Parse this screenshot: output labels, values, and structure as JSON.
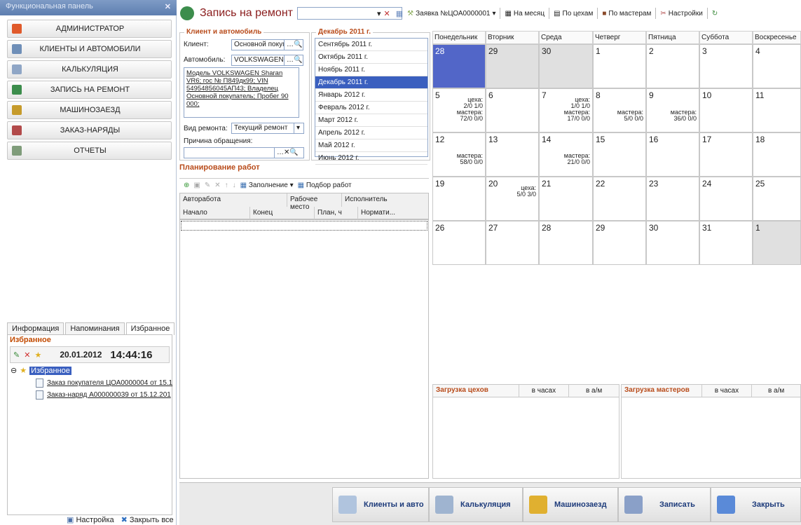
{
  "left_panel": {
    "title": "Функциональная панель",
    "close": "✕",
    "nav": [
      {
        "label": "АДМИНИСТРАТОР",
        "icon": "admin-icon",
        "color": "#e05a2b"
      },
      {
        "label": "КЛИЕНТЫ И АВТОМОБИЛИ",
        "icon": "clients-icon",
        "color": "#6f8fb8"
      },
      {
        "label": "КАЛЬКУЛЯЦИЯ",
        "icon": "calc-icon",
        "color": "#8fa6c6"
      },
      {
        "label": "ЗАПИСЬ НА РЕМОНТ",
        "icon": "record-icon",
        "color": "#3c8d4c"
      },
      {
        "label": "МАШИНОЗАЕЗД",
        "icon": "car-icon",
        "color": "#c69b2b"
      },
      {
        "label": "ЗАКАЗ-НАРЯДЫ",
        "icon": "tools-icon",
        "color": "#b24a4a"
      },
      {
        "label": "ОТЧЕТЫ",
        "icon": "reports-icon",
        "color": "#7f9c7a"
      }
    ],
    "tabs": [
      "Информация",
      "Напоминания",
      "Избранное"
    ],
    "fav_header": "Избранное",
    "date": "20.01.2012",
    "time": "14:44:16",
    "tree_root": "Избранное",
    "items": [
      "Заказ покупателя ЦОА0000004 от 15.1",
      "Заказ-наряд А000000039 от 15.12.201"
    ],
    "footer": [
      "Настройка",
      "Закрыть все"
    ]
  },
  "main": {
    "title": "Запись на ремонт",
    "toolbar": [
      "Заявка №ЦОА0000001",
      "На месяц",
      "По цехам",
      "По мастерам",
      "Настройки"
    ],
    "client_group": "Клиент и автомобиль",
    "client_label": "Клиент:",
    "client_value": "Основной покуг",
    "car_label": "Автомобиль:",
    "car_value": "VOLKSWAGEN !",
    "info": "Модель VOLKSWAGEN Sharan VR6; гос № П849дк99; VIN 54954856045АП43; Владелец Основной покупатель; Пробег 90 000;",
    "repair_label": "Вид ремонта:",
    "repair_value": "Текущий ремонт",
    "reason_label": "Причина обращения:",
    "month_group": "Декабрь 2011 г.",
    "months": [
      "Сентябрь 2011 г.",
      "Октябрь 2011 г.",
      "Ноябрь 2011 г.",
      "Декабрь 2011 г.",
      "Январь 2012 г.",
      "Февраль 2012 г.",
      "Март 2012 г.",
      "Апрель 2012 г.",
      "Май 2012 г.",
      "Июнь 2012 г."
    ],
    "selected_month": 3,
    "plan_title": "Планирование работ",
    "plan_tools": [
      "Заполнение",
      "Подбор работ"
    ],
    "plan_cols1": [
      "Авторабота",
      "Рабочее место",
      "Исполнитель"
    ],
    "plan_cols2": [
      "Начало",
      "Конец",
      "План, ч",
      "Нормати..."
    ]
  },
  "calendar": {
    "days": [
      "Понедельник",
      "Вторник",
      "Среда",
      "Четверг",
      "Пятница",
      "Суббота",
      "Воскресенье"
    ],
    "weeks": [
      [
        "28",
        "29",
        "30",
        "1",
        "2",
        "3",
        "4"
      ],
      [
        "5",
        "6",
        "7",
        "8",
        "9",
        "10",
        "11"
      ],
      [
        "12",
        "13",
        "14",
        "15",
        "16",
        "17",
        "18"
      ],
      [
        "19",
        "20",
        "21",
        "22",
        "23",
        "24",
        "25"
      ],
      [
        "26",
        "27",
        "28",
        "29",
        "30",
        "31",
        "1"
      ]
    ],
    "notes": {
      "w1_mon": "цеха:\n2/0 1/0\nмастера:\n72/0 0/0",
      "w1_wed": "цеха:\n1/0 1/0\nмастера:\n17/0 0/0",
      "w1_thu": "мастера:\n5/0 0/0",
      "w1_fri": "мастера:\n36/0 0/0",
      "w2_mon": "мастера:\n58/0 0/0",
      "w2_wed": "мастера:\n21/0 0/0",
      "w3_tue": "цеха:\n5/0 3/0"
    },
    "load_shops": "Загрузка цехов",
    "load_masters": "Загрузка мастеров",
    "in_hours": "в часах",
    "in_am": "в а/м"
  },
  "bottom": [
    "Клиенты и авто",
    "Калькуляция",
    "Машинозаезд",
    "Записать",
    "Закрыть"
  ]
}
